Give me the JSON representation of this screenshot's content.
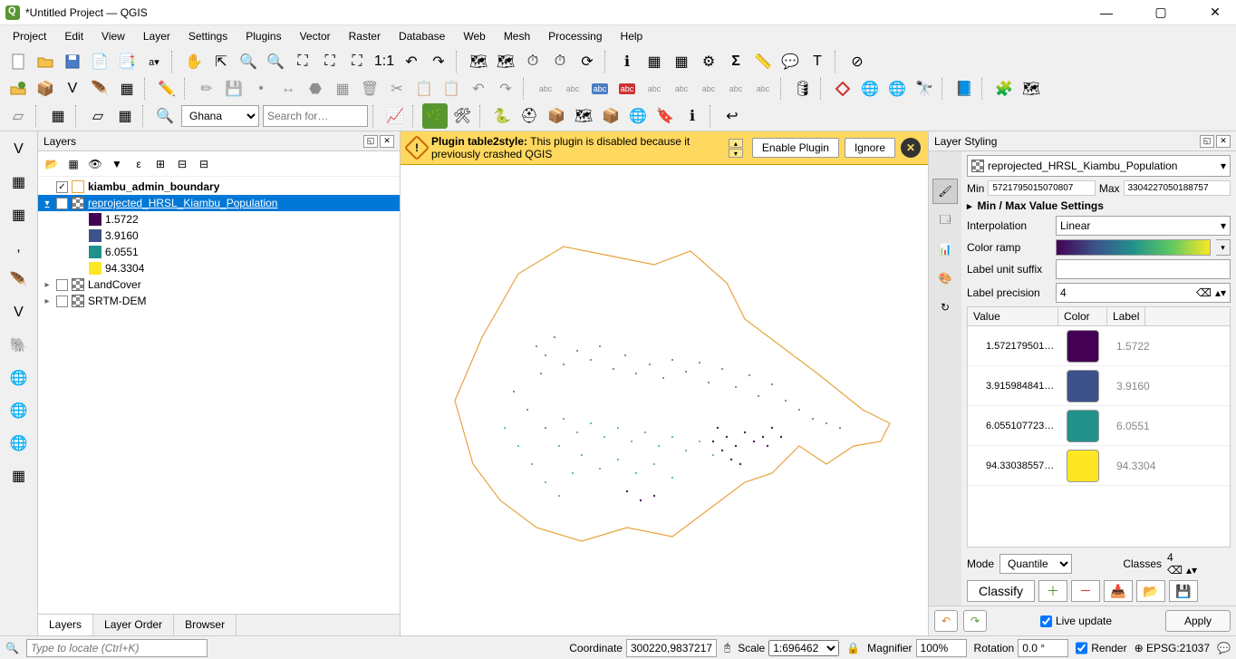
{
  "title": "*Untitled Project — QGIS",
  "menu": [
    "Project",
    "Edit",
    "View",
    "Layer",
    "Settings",
    "Plugins",
    "Vector",
    "Raster",
    "Database",
    "Web",
    "Mesh",
    "Processing",
    "Help"
  ],
  "toolbar3": {
    "select_value": "Ghana",
    "search_placeholder": "Search for…"
  },
  "layers_panel": {
    "title": "Layers",
    "tabs": [
      "Layers",
      "Layer Order",
      "Browser"
    ],
    "items": [
      {
        "name": "kiambu_admin_boundary",
        "checked": true,
        "bold": true,
        "icon": "line"
      },
      {
        "name": "reprojected_HRSL_Kiambu_Population",
        "checked": true,
        "selected": true,
        "expanded": true,
        "icon": "raster",
        "legend": [
          {
            "color": "#440154",
            "label": "1.5722"
          },
          {
            "color": "#3b528b",
            "label": "3.9160"
          },
          {
            "color": "#21918c",
            "label": "6.0551"
          },
          {
            "color": "#fde725",
            "label": "94.3304"
          }
        ]
      },
      {
        "name": "LandCover",
        "checked": false,
        "icon": "raster"
      },
      {
        "name": "SRTM-DEM",
        "checked": false,
        "icon": "raster"
      }
    ]
  },
  "message": {
    "title": "Plugin table2style:",
    "body": "This plugin is disabled because it previously crashed QGIS",
    "enable": "Enable Plugin",
    "ignore": "Ignore"
  },
  "styling": {
    "title": "Layer Styling",
    "layer": "reprojected_HRSL_Kiambu_Population",
    "min_label": "Min",
    "min_val": "5721795015070807",
    "max_label": "Max",
    "max_val": "3304227050188757",
    "minmax_settings": "Min / Max Value Settings",
    "interpolation_lbl": "Interpolation",
    "interpolation": "Linear",
    "colorramp_lbl": "Color ramp",
    "suffix_lbl": "Label unit suffix",
    "suffix": "",
    "precision_lbl": "Label precision",
    "precision": "4",
    "col_value": "Value",
    "col_color": "Color",
    "col_label": "Label",
    "rows": [
      {
        "value": "1.572179501…",
        "color": "#440154",
        "label": "1.5722"
      },
      {
        "value": "3.915984841…",
        "color": "#3b528b",
        "label": "3.9160"
      },
      {
        "value": "6.055107723…",
        "color": "#21918c",
        "label": "6.0551"
      },
      {
        "value": "94.33038557…",
        "color": "#fde725",
        "label": "94.3304"
      }
    ],
    "mode_lbl": "Mode",
    "mode": "Quantile",
    "classes_lbl": "Classes",
    "classes": "4",
    "classify": "Classify",
    "live": "Live update",
    "apply": "Apply"
  },
  "status": {
    "locate_placeholder": "Type to locate (Ctrl+K)",
    "coord_lbl": "Coordinate",
    "coord": "300220,9837217",
    "scale_lbl": "Scale",
    "scale": "1:696462",
    "mag_lbl": "Magnifier",
    "mag": "100%",
    "rot_lbl": "Rotation",
    "rot": "0.0 °",
    "render": "Render",
    "epsg": "EPSG:21037"
  }
}
